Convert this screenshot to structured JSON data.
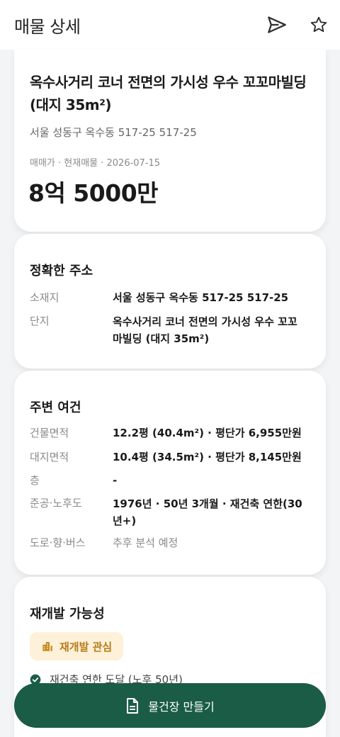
{
  "header": {
    "title": "매물 상세",
    "share_icon": "send-icon",
    "favorite_icon": "star-outline-icon"
  },
  "summary": {
    "title": "옥수사거리 코너 전면의 가시성 우수 꼬꼬마빌딩 (대지 35m²)",
    "address": "서울 성동구 옥수동 517-25 517-25",
    "meta": "매매가 · 현재매물 · 2026-07-15",
    "price": "8억 5000만"
  },
  "address_section": {
    "title": "정확한 주소",
    "rows": [
      {
        "key": "소재지",
        "value": "서울 성동구 옥수동 517-25 517-25"
      },
      {
        "key": "단지",
        "value": "옥수사거리 코너 전면의 가시성 우수 꼬꼬마빌딩 (대지 35m²)"
      }
    ]
  },
  "surroundings": {
    "title": "주변 여건",
    "rows": [
      {
        "key": "건물면적",
        "value": "12.2평 (40.4m²) · 평단가 6,955만원"
      },
      {
        "key": "대지면적",
        "value": "10.4평 (34.5m²) · 평단가 8,145만원"
      },
      {
        "key": "층",
        "value": "-"
      },
      {
        "key": "준공·노후도",
        "value": "1976년 · 50년 3개월 · 재건축 연한(30년+)"
      },
      {
        "key": "도로·향·버스",
        "value": "추후 분석 예정"
      }
    ]
  },
  "redevelopment": {
    "title": "재개발 가능성",
    "badge": "재개발 관심",
    "badge_icon": "building-icon",
    "check_item": "재건축 연한 도달 (노후 50년)"
  },
  "cta": {
    "label": "물건장 만들기",
    "icon": "document-icon"
  },
  "colors": {
    "primary": "#1a5c45",
    "badge_bg": "#fdf1d9",
    "badge_text": "#b87a17"
  }
}
